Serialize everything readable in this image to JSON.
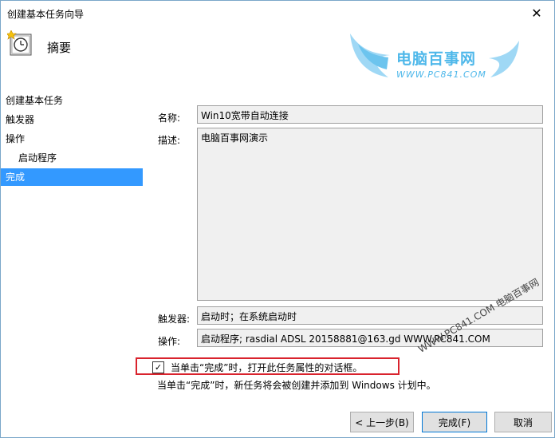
{
  "window": {
    "title": "创建基本任务向导",
    "close_label": "✕"
  },
  "header": {
    "title": "摘要"
  },
  "watermark": {
    "brand": "电脑百事网",
    "url": "WWW.PC841.COM",
    "diagonal": "WWW.PC841.COM 电脑百事网"
  },
  "sidebar": {
    "items": [
      {
        "label": "创建基本任务"
      },
      {
        "label": "触发器"
      },
      {
        "label": "操作"
      },
      {
        "label": "启动程序"
      },
      {
        "label": "完成"
      }
    ]
  },
  "form": {
    "name_label": "名称:",
    "name_value": "Win10宽带自动连接",
    "desc_label": "描述:",
    "desc_value": "电脑百事网演示",
    "trigger_label": "触发器:",
    "trigger_value": "启动时；在系统启动时",
    "action_label": "操作:",
    "action_value": "启动程序; rasdial ADSL 20158881@163.gd WWW.PC841.COM"
  },
  "checkbox": {
    "label": "当单击“完成”时，打开此任务属性的对话框。",
    "checked": true,
    "mark": "✓"
  },
  "note": "当单击“完成”时，新任务将会被创建并添加到 Windows 计划中。",
  "buttons": {
    "back": "< 上一步(B)",
    "finish": "完成(F)",
    "cancel": "取消"
  },
  "colors": {
    "accent": "#3399ff",
    "highlight_border": "#d9232d",
    "watermark": "#4fb8ea"
  }
}
